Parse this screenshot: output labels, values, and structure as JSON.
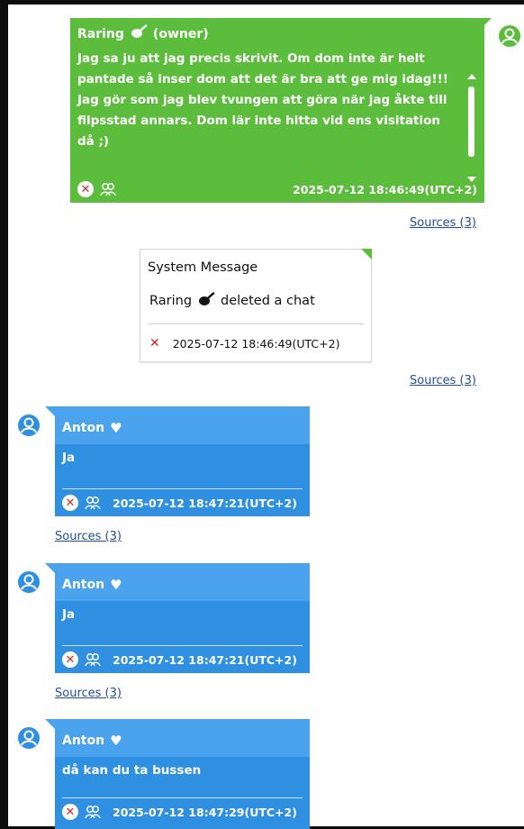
{
  "messages": [
    {
      "sender": "Raring",
      "sender_emoji": "ponytail-icon",
      "role": "(owner)",
      "text": "Jag sa ju att jag precis skrivit. Om dom inte är helt pantade så inser dom att det är bra att ge mig idag!!! Jag gör som jag blev tvungen att göra när jag åkte till filpsstad annars. Dom lär inte hitta vid ens visitation då ;)",
      "timestamp": "2025-07-12 18:46:49(UTC+2)",
      "sources": "Sources (3)"
    },
    {
      "type": "system",
      "title": "System Message",
      "actor": "Raring",
      "action": "deleted a chat",
      "timestamp": "2025-07-12 18:46:49(UTC+2)",
      "sources": "Sources (3)"
    },
    {
      "sender": "Anton",
      "sender_emoji": "heart-icon",
      "text": "Ja",
      "timestamp": "2025-07-12 18:47:21(UTC+2)",
      "sources": "Sources (3)"
    },
    {
      "sender": "Anton",
      "sender_emoji": "heart-icon",
      "text": "Ja",
      "timestamp": "2025-07-12 18:47:21(UTC+2)",
      "sources": "Sources (3)"
    },
    {
      "sender": "Anton",
      "sender_emoji": "heart-icon",
      "text": "då kan du ta bussen",
      "timestamp": "2025-07-12 18:47:29(UTC+2)"
    }
  ],
  "colors": {
    "owner_bubble": "#5cbd3d",
    "participant_bubble": "#2f8fe0",
    "participant_header": "#4aa3ec",
    "link": "#1f4e9c",
    "delete_red": "#e02020"
  }
}
